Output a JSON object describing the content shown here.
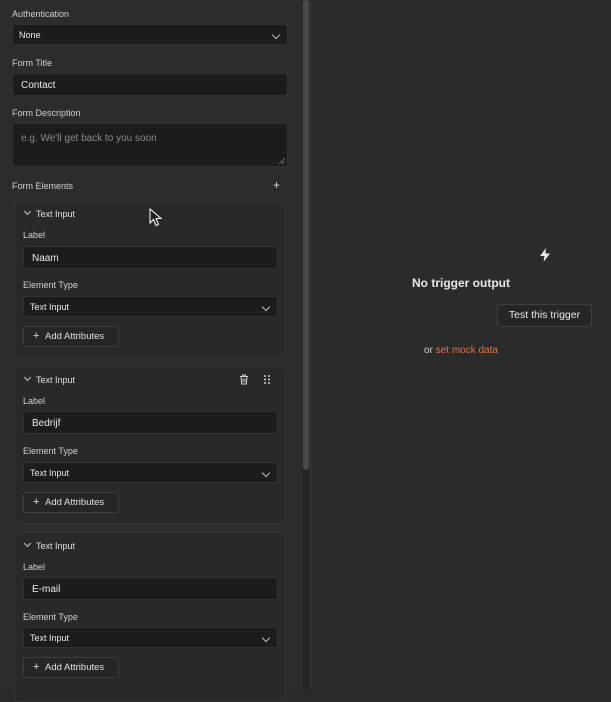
{
  "auth": {
    "label": "Authentication",
    "value": "None"
  },
  "form_title": {
    "label": "Form Title",
    "value": "Contact"
  },
  "form_description": {
    "label": "Form Description",
    "placeholder": "e.g. We'll get back to you soon"
  },
  "form_elements": {
    "label": "Form Elements",
    "items": [
      {
        "title": "Text Input",
        "label_caption": "Label",
        "label_value": "Naam",
        "type_caption": "Element Type",
        "type_value": "Text Input",
        "add_attr": "Add Attributes"
      },
      {
        "title": "Text Input",
        "label_caption": "Label",
        "label_value": "Bedrijf",
        "type_caption": "Element Type",
        "type_value": "Text Input",
        "add_attr": "Add Attributes"
      },
      {
        "title": "Text Input",
        "label_caption": "Label",
        "label_value": "E-mail",
        "type_caption": "Element Type",
        "type_value": "Text Input",
        "add_attr": "Add Attributes"
      }
    ]
  },
  "output": {
    "empty_title": "No trigger output",
    "test_button": "Test this trigger",
    "or_text": "or",
    "mock_link": "set mock data"
  },
  "colors": {
    "accent": "#e8734a",
    "background": "#2a2a2a",
    "field": "#1c1c1c"
  },
  "icons": [
    "chevron-down-icon",
    "plus-icon",
    "trash-icon",
    "drag-handle-icon",
    "lightning-icon",
    "mouse-cursor-icon"
  ]
}
